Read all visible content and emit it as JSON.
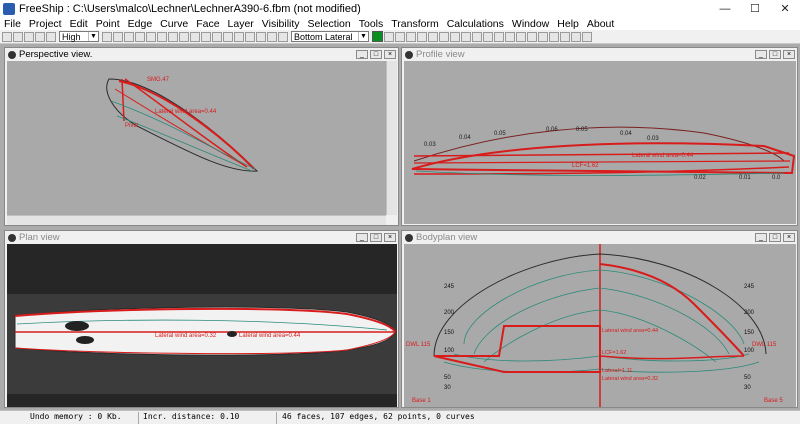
{
  "window": {
    "title": "FreeShip : C:\\Users\\malco\\Lechner\\LechnerA390-6.fbm (not modified)",
    "minimize": "—",
    "maximize": "☐",
    "close": "✕"
  },
  "menu": [
    "File",
    "Project",
    "Edit",
    "Point",
    "Edge",
    "Curve",
    "Face",
    "Layer",
    "Visibility",
    "Selection",
    "Tools",
    "Transform",
    "Calculations",
    "Window",
    "Help",
    "About"
  ],
  "toolbar": {
    "precision_value": "High",
    "layer_value": "Bottom Lateral"
  },
  "views": {
    "perspective": {
      "title": "Perspective view.",
      "labels": [
        "SMG.47",
        "Lateral wind area=0.44",
        "Pivot"
      ]
    },
    "profile": {
      "title": "Profile view",
      "labels": [
        "0.03",
        "0.04",
        "0.05",
        "0.06",
        "0.05",
        "0.04",
        "0.03",
        "0.02",
        "0.01",
        "0.0",
        "LCF=1.62",
        "Lateral wind area=0.44"
      ]
    },
    "plan": {
      "title": "Plan view",
      "labels": [
        "Lateral wind area=0.32",
        "Lateral wind area=0.44"
      ]
    },
    "bodyplan": {
      "title": "Bodyplan view",
      "left_scale": [
        "245",
        "200",
        "150",
        "100",
        "50",
        "30"
      ],
      "right_scale": [
        "245",
        "200",
        "150",
        "100",
        "50",
        "30"
      ],
      "center_labels": [
        "Lateral wind area=0.44",
        "LCF=1.62",
        "Lateral=1.11",
        "Lateral wind area=0.32"
      ],
      "dwl_left": "DWL 115",
      "dwl_right": "DWL 115",
      "base_left": "Base 1",
      "base_right": "Base 5"
    }
  },
  "status": {
    "undo": "Undo memory : 0 Kb.",
    "distance": "Incr. distance: 0.10",
    "counts": "46 faces, 107 edges, 62 points, 0 curves"
  },
  "colors": {
    "hull_red": "#d81c1c",
    "waterline_teal": "#2b8a7a",
    "canvas_gray": "#a9a9a9",
    "green_button": "#0a8f20"
  }
}
